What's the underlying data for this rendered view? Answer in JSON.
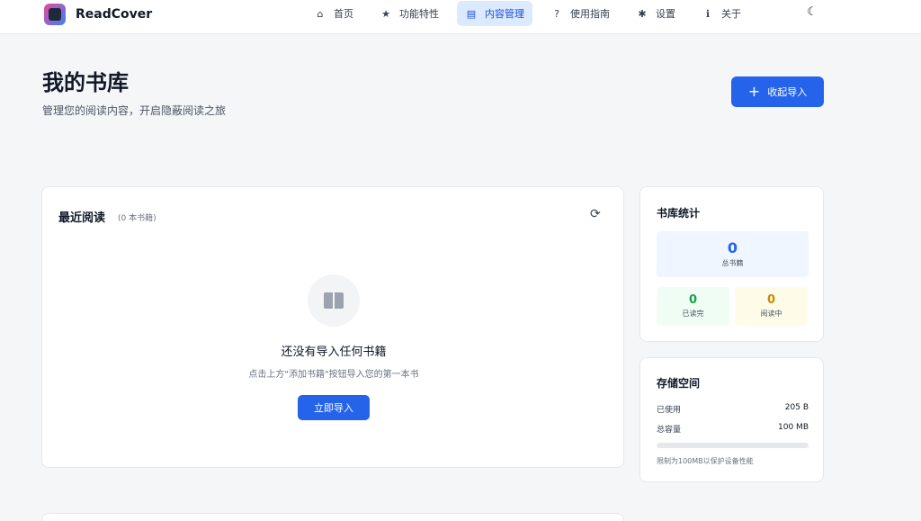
{
  "brand": {
    "name": "ReadCover"
  },
  "nav": [
    {
      "label": "首页",
      "icon": "home-icon",
      "glyph": "⌂",
      "active": false
    },
    {
      "label": "功能特性",
      "icon": "star-icon",
      "glyph": "★",
      "active": false
    },
    {
      "label": "内容管理",
      "icon": "book-icon",
      "glyph": "▤",
      "active": true
    },
    {
      "label": "使用指南",
      "icon": "question-icon",
      "glyph": "?",
      "active": false
    },
    {
      "label": "设置",
      "icon": "gear-icon",
      "glyph": "✱",
      "active": false
    },
    {
      "label": "关于",
      "icon": "info-icon",
      "glyph": "ℹ",
      "active": false
    }
  ],
  "header": {
    "title": "我的书库",
    "subtitle": "管理您的阅读内容，开启隐蔽阅读之旅",
    "action_label": "收起导入"
  },
  "recent": {
    "title": "最近阅读",
    "count_label": "(0 本书籍)",
    "empty_title": "还没有导入任何书籍",
    "empty_desc": "点击上方\"添加书籍\"按钮导入您的第一本书",
    "import_label": "立即导入"
  },
  "stats": {
    "title": "书库统计",
    "total": {
      "value": "0",
      "label": "总书籍"
    },
    "done": {
      "value": "0",
      "label": "已读完"
    },
    "reading": {
      "value": "0",
      "label": "阅读中"
    }
  },
  "storage": {
    "title": "存储空间",
    "used_label": "已使用",
    "used_value": "205 B",
    "total_label": "总容量",
    "total_value": "100 MB",
    "used_fraction": 2e-06,
    "note": "限制为100MB以保护设备性能"
  },
  "colors": {
    "accent": "#2563eb",
    "active_nav_bg": "#dbeafe"
  }
}
